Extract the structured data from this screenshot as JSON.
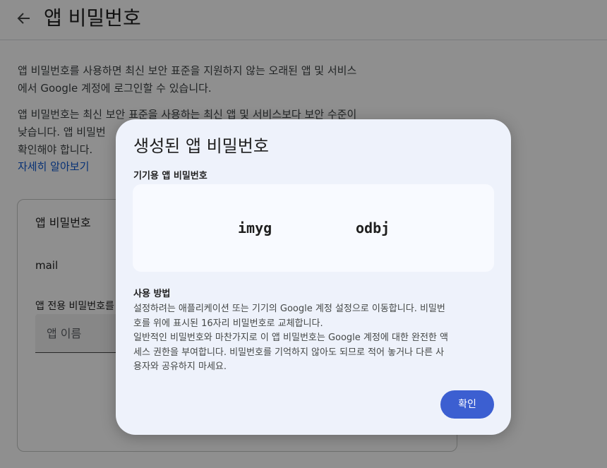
{
  "page": {
    "title": "앱 비밀번호",
    "intro_lines": [
      "앱 비밀번호를 사용하면 최신 보안 표준을 지원하지 않는 오래된 앱 및 서비스",
      "에서 Google 계정에 로그인할 수 있습니다."
    ],
    "warning_lines": [
      "앱 비밀번호는 최신 보안 표준을 사용하는 최신 앱 및 서비스보다 보안 수준이",
      "낮습니다. 앱 비밀번",
      "확인해야 합니다."
    ],
    "learn_more": "자세히 알아보기",
    "card": {
      "title": "앱 비밀번호",
      "mail": "mail",
      "label": "앱 전용 비밀번호를",
      "input_placeholder": "앱 이름"
    }
  },
  "dialog": {
    "title": "생성된 앱 비밀번호",
    "subtitle": "기기용 앱 비밀번호",
    "password_groups": [
      "imyg",
      "odbj"
    ],
    "usage_title": "사용 방법",
    "usage_lines": [
      "설정하려는 애플리케이션 또는 기기의 Google 계정 설정으로 이동합니다. 비밀번",
      "호를 위에 표시된 16자리 비밀번호로 교체합니다.",
      "일반적인 비밀번호와 마찬가지로 이 앱 비밀번호는 Google 계정에 대한 완전한 액",
      "세스 권한을 부여합니다. 비밀번호를 기억하지 않아도 되므로 적어 놓거나 다른 사",
      "용자와 공유하지 마세요."
    ],
    "confirm_label": "확인"
  },
  "icons": {
    "back": "arrow-back-icon"
  },
  "colors": {
    "accent": "#3c5fd1",
    "link": "#0b57d0",
    "dialog_bg": "#eef2fb"
  }
}
